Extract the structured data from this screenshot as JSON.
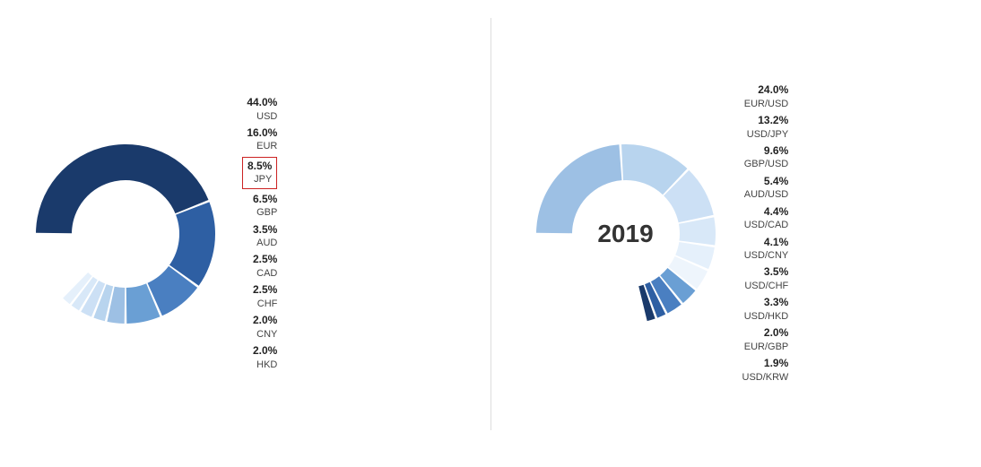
{
  "left_chart": {
    "center_label": "",
    "items": [
      {
        "pct": "44.0%",
        "label": "USD",
        "color": "#1a3a6b",
        "angle": 158.4,
        "highlighted": false
      },
      {
        "pct": "16.0%",
        "label": "EUR",
        "color": "#2e5fa3",
        "angle": 57.6,
        "highlighted": false
      },
      {
        "pct": "8.5%",
        "label": "JPY",
        "color": "#4a7fc1",
        "angle": 30.6,
        "highlighted": true
      },
      {
        "pct": "6.5%",
        "label": "GBP",
        "color": "#6a9fd4",
        "angle": 23.4,
        "highlighted": false
      },
      {
        "pct": "3.5%",
        "label": "AUD",
        "color": "#9dc0e4",
        "angle": 12.6,
        "highlighted": false
      },
      {
        "pct": "2.5%",
        "label": "CAD",
        "color": "#b8d4ee",
        "angle": 9.0,
        "highlighted": false
      },
      {
        "pct": "2.5%",
        "label": "CHF",
        "color": "#cce0f5",
        "angle": 9.0,
        "highlighted": false
      },
      {
        "pct": "2.0%",
        "label": "CNY",
        "color": "#d8e8f8",
        "angle": 7.2,
        "highlighted": false
      },
      {
        "pct": "2.0%",
        "label": "HKD",
        "color": "#e5f0fb",
        "angle": 7.2,
        "highlighted": false
      }
    ]
  },
  "right_chart": {
    "center_label": "2019",
    "items": [
      {
        "pct": "24.0%",
        "label": "EUR/USD",
        "color": "#9dc0e4",
        "angle": 86.4
      },
      {
        "pct": "13.2%",
        "label": "USD/JPY",
        "color": "#b8d4ee",
        "angle": 47.52
      },
      {
        "pct": "9.6%",
        "label": "GBP/USD",
        "color": "#cce0f5",
        "angle": 34.56
      },
      {
        "pct": "5.4%",
        "label": "AUD/USD",
        "color": "#d8e8f8",
        "angle": 19.44
      },
      {
        "pct": "4.4%",
        "label": "USD/CAD",
        "color": "#e5f0fb",
        "angle": 15.84
      },
      {
        "pct": "4.1%",
        "label": "USD/CNY",
        "color": "#eef5fc",
        "angle": 14.76
      },
      {
        "pct": "3.5%",
        "label": "USD/CHF",
        "color": "#6a9fd4",
        "angle": 12.6
      },
      {
        "pct": "3.3%",
        "label": "USD/HKD",
        "color": "#4a7fc1",
        "angle": 11.88
      },
      {
        "pct": "2.0%",
        "label": "EUR/GBP",
        "color": "#2e5fa3",
        "angle": 7.2
      },
      {
        "pct": "1.9%",
        "label": "USD/KRW",
        "color": "#1a3a6b",
        "angle": 6.84
      }
    ]
  }
}
